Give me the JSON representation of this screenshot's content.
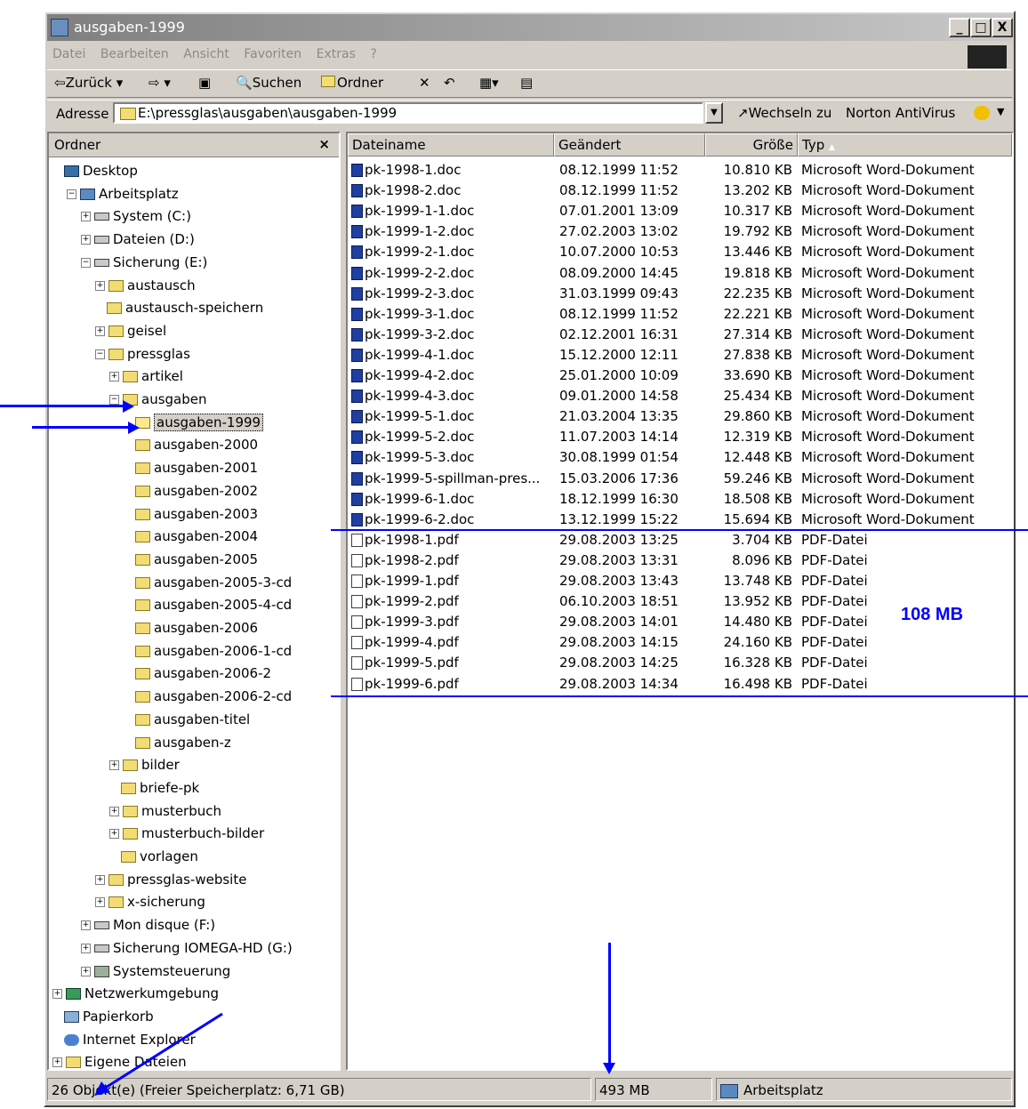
{
  "window": {
    "title": "ausgaben-1999"
  },
  "titlebar_buttons": [
    "_",
    "□",
    "X"
  ],
  "menu": [
    "Datei",
    "Bearbeiten",
    "Ansicht",
    "Favoriten",
    "Extras",
    "?"
  ],
  "toolbar": {
    "back": "⇦Zurück ▾",
    "forward": "⇨ ▾",
    "up": "▣",
    "search": "Suchen",
    "folders": "Ordner",
    "delete": "✕",
    "undo": "↶",
    "views": "▦▾",
    "props": "▤"
  },
  "address": {
    "label": "Adresse",
    "path": "E:\\pressglas\\ausgaben\\ausgaben-1999",
    "go": "Wechseln zu",
    "norton": "Norton AntiVirus"
  },
  "tree": {
    "header": "Ordner",
    "close": "×",
    "items": [
      {
        "label": "Desktop",
        "expander": "",
        "icon": "desktop-icon"
      },
      {
        "label": "Arbeitsplatz",
        "expander": "−",
        "icon": "computer-icon"
      },
      {
        "label": "System (C:)",
        "expander": "+",
        "icon": "drive-icon"
      },
      {
        "label": "Dateien (D:)",
        "expander": "+",
        "icon": "drive-icon"
      },
      {
        "label": "Sicherung (E:)",
        "expander": "−",
        "icon": "drive-icon"
      },
      {
        "label": "austausch",
        "expander": "+",
        "icon": "folder-icon"
      },
      {
        "label": "austausch-speichern",
        "expander": "",
        "icon": "folder-icon"
      },
      {
        "label": "geisel",
        "expander": "+",
        "icon": "folder-icon"
      },
      {
        "label": "pressglas",
        "expander": "−",
        "icon": "folder-icon"
      },
      {
        "label": "artikel",
        "expander": "+",
        "icon": "folder-icon"
      },
      {
        "label": "ausgaben",
        "expander": "−",
        "icon": "folder-icon"
      },
      {
        "label": "ausgaben-1999",
        "expander": "",
        "icon": "folder-open-icon"
      },
      {
        "label": "ausgaben-2000",
        "expander": "",
        "icon": "folder-icon"
      },
      {
        "label": "ausgaben-2001",
        "expander": "",
        "icon": "folder-icon"
      },
      {
        "label": "ausgaben-2002",
        "expander": "",
        "icon": "folder-icon"
      },
      {
        "label": "ausgaben-2003",
        "expander": "",
        "icon": "folder-icon"
      },
      {
        "label": "ausgaben-2004",
        "expander": "",
        "icon": "folder-icon"
      },
      {
        "label": "ausgaben-2005",
        "expander": "",
        "icon": "folder-icon"
      },
      {
        "label": "ausgaben-2005-3-cd",
        "expander": "",
        "icon": "folder-icon"
      },
      {
        "label": "ausgaben-2005-4-cd",
        "expander": "",
        "icon": "folder-icon"
      },
      {
        "label": "ausgaben-2006",
        "expander": "",
        "icon": "folder-icon"
      },
      {
        "label": "ausgaben-2006-1-cd",
        "expander": "",
        "icon": "folder-icon"
      },
      {
        "label": "ausgaben-2006-2",
        "expander": "",
        "icon": "folder-icon"
      },
      {
        "label": "ausgaben-2006-2-cd",
        "expander": "",
        "icon": "folder-icon"
      },
      {
        "label": "ausgaben-titel",
        "expander": "",
        "icon": "folder-icon"
      },
      {
        "label": "ausgaben-z",
        "expander": "",
        "icon": "folder-icon"
      },
      {
        "label": "bilder",
        "expander": "+",
        "icon": "folder-icon"
      },
      {
        "label": "briefe-pk",
        "expander": "",
        "icon": "folder-icon"
      },
      {
        "label": "musterbuch",
        "expander": "+",
        "icon": "folder-icon"
      },
      {
        "label": "musterbuch-bilder",
        "expander": "+",
        "icon": "folder-icon"
      },
      {
        "label": "vorlagen",
        "expander": "",
        "icon": "folder-icon"
      },
      {
        "label": "pressglas-website",
        "expander": "+",
        "icon": "folder-icon"
      },
      {
        "label": "x-sicherung",
        "expander": "+",
        "icon": "folder-icon"
      },
      {
        "label": "Mon disque (F:)",
        "expander": "+",
        "icon": "drive-icon"
      },
      {
        "label": "Sicherung IOMEGA-HD (G:)",
        "expander": "+",
        "icon": "drive-icon"
      },
      {
        "label": "Systemsteuerung",
        "expander": "+",
        "icon": "control-panel-icon"
      },
      {
        "label": "Netzwerkumgebung",
        "expander": "+",
        "icon": "network-icon"
      },
      {
        "label": "Papierkorb",
        "expander": "",
        "icon": "recycle-bin-icon"
      },
      {
        "label": "Internet Explorer",
        "expander": "",
        "icon": "internet-explorer-icon"
      },
      {
        "label": "Eigene Dateien",
        "expander": "+",
        "icon": "folder-icon"
      }
    ],
    "selected_index": 11
  },
  "list": {
    "columns": [
      "Dateiname",
      "Geändert",
      "Größe",
      "Typ"
    ],
    "sort_indicator": "▲",
    "rows": [
      {
        "name": "pk-1998-1.doc",
        "modified": "08.12.1999 11:52",
        "size": "10.810 KB",
        "type": "Microsoft Word-Dokument",
        "kind": "doc"
      },
      {
        "name": "pk-1998-2.doc",
        "modified": "08.12.1999 11:52",
        "size": "13.202 KB",
        "type": "Microsoft Word-Dokument",
        "kind": "doc"
      },
      {
        "name": "pk-1999-1-1.doc",
        "modified": "07.01.2001 13:09",
        "size": "10.317 KB",
        "type": "Microsoft Word-Dokument",
        "kind": "doc"
      },
      {
        "name": "pk-1999-1-2.doc",
        "modified": "27.02.2003 13:02",
        "size": "19.792 KB",
        "type": "Microsoft Word-Dokument",
        "kind": "doc"
      },
      {
        "name": "pk-1999-2-1.doc",
        "modified": "10.07.2000 10:53",
        "size": "13.446 KB",
        "type": "Microsoft Word-Dokument",
        "kind": "doc"
      },
      {
        "name": "pk-1999-2-2.doc",
        "modified": "08.09.2000 14:45",
        "size": "19.818 KB",
        "type": "Microsoft Word-Dokument",
        "kind": "doc"
      },
      {
        "name": "pk-1999-2-3.doc",
        "modified": "31.03.1999 09:43",
        "size": "22.235 KB",
        "type": "Microsoft Word-Dokument",
        "kind": "doc"
      },
      {
        "name": "pk-1999-3-1.doc",
        "modified": "08.12.1999 11:52",
        "size": "22.221 KB",
        "type": "Microsoft Word-Dokument",
        "kind": "doc"
      },
      {
        "name": "pk-1999-3-2.doc",
        "modified": "02.12.2001 16:31",
        "size": "27.314 KB",
        "type": "Microsoft Word-Dokument",
        "kind": "doc"
      },
      {
        "name": "pk-1999-4-1.doc",
        "modified": "15.12.2000 12:11",
        "size": "27.838 KB",
        "type": "Microsoft Word-Dokument",
        "kind": "doc"
      },
      {
        "name": "pk-1999-4-2.doc",
        "modified": "25.01.2000 10:09",
        "size": "33.690 KB",
        "type": "Microsoft Word-Dokument",
        "kind": "doc"
      },
      {
        "name": "pk-1999-4-3.doc",
        "modified": "09.01.2000 14:58",
        "size": "25.434 KB",
        "type": "Microsoft Word-Dokument",
        "kind": "doc"
      },
      {
        "name": "pk-1999-5-1.doc",
        "modified": "21.03.2004 13:35",
        "size": "29.860 KB",
        "type": "Microsoft Word-Dokument",
        "kind": "doc"
      },
      {
        "name": "pk-1999-5-2.doc",
        "modified": "11.07.2003 14:14",
        "size": "12.319 KB",
        "type": "Microsoft Word-Dokument",
        "kind": "doc"
      },
      {
        "name": "pk-1999-5-3.doc",
        "modified": "30.08.1999 01:54",
        "size": "12.448 KB",
        "type": "Microsoft Word-Dokument",
        "kind": "doc"
      },
      {
        "name": "pk-1999-5-spillman-pres...",
        "modified": "15.03.2006 17:36",
        "size": "59.246 KB",
        "type": "Microsoft Word-Dokument",
        "kind": "doc"
      },
      {
        "name": "pk-1999-6-1.doc",
        "modified": "18.12.1999 16:30",
        "size": "18.508 KB",
        "type": "Microsoft Word-Dokument",
        "kind": "doc"
      },
      {
        "name": "pk-1999-6-2.doc",
        "modified": "13.12.1999 15:22",
        "size": "15.694 KB",
        "type": "Microsoft Word-Dokument",
        "kind": "doc"
      },
      {
        "name": "pk-1998-1.pdf",
        "modified": "29.08.2003 13:25",
        "size": "3.704 KB",
        "type": "PDF-Datei",
        "kind": "pdf"
      },
      {
        "name": "pk-1998-2.pdf",
        "modified": "29.08.2003 13:31",
        "size": "8.096 KB",
        "type": "PDF-Datei",
        "kind": "pdf"
      },
      {
        "name": "pk-1999-1.pdf",
        "modified": "29.08.2003 13:43",
        "size": "13.748 KB",
        "type": "PDF-Datei",
        "kind": "pdf"
      },
      {
        "name": "pk-1999-2.pdf",
        "modified": "06.10.2003 18:51",
        "size": "13.952 KB",
        "type": "PDF-Datei",
        "kind": "pdf"
      },
      {
        "name": "pk-1999-3.pdf",
        "modified": "29.08.2003 14:01",
        "size": "14.480 KB",
        "type": "PDF-Datei",
        "kind": "pdf"
      },
      {
        "name": "pk-1999-4.pdf",
        "modified": "29.08.2003 14:15",
        "size": "24.160 KB",
        "type": "PDF-Datei",
        "kind": "pdf"
      },
      {
        "name": "pk-1999-5.pdf",
        "modified": "29.08.2003 14:25",
        "size": "16.328 KB",
        "type": "PDF-Datei",
        "kind": "pdf"
      },
      {
        "name": "pk-1999-6.pdf",
        "modified": "29.08.2003 14:34",
        "size": "16.498 KB",
        "type": "PDF-Datei",
        "kind": "pdf"
      }
    ]
  },
  "status": {
    "objects": "26 Objekt(e)  (Freier Speicherplatz: 6,71 GB)",
    "size": "493 MB",
    "zone": "Arbeitsplatz"
  },
  "annotation": {
    "pdf_total": "108 MB",
    "color": "#0000ff"
  }
}
